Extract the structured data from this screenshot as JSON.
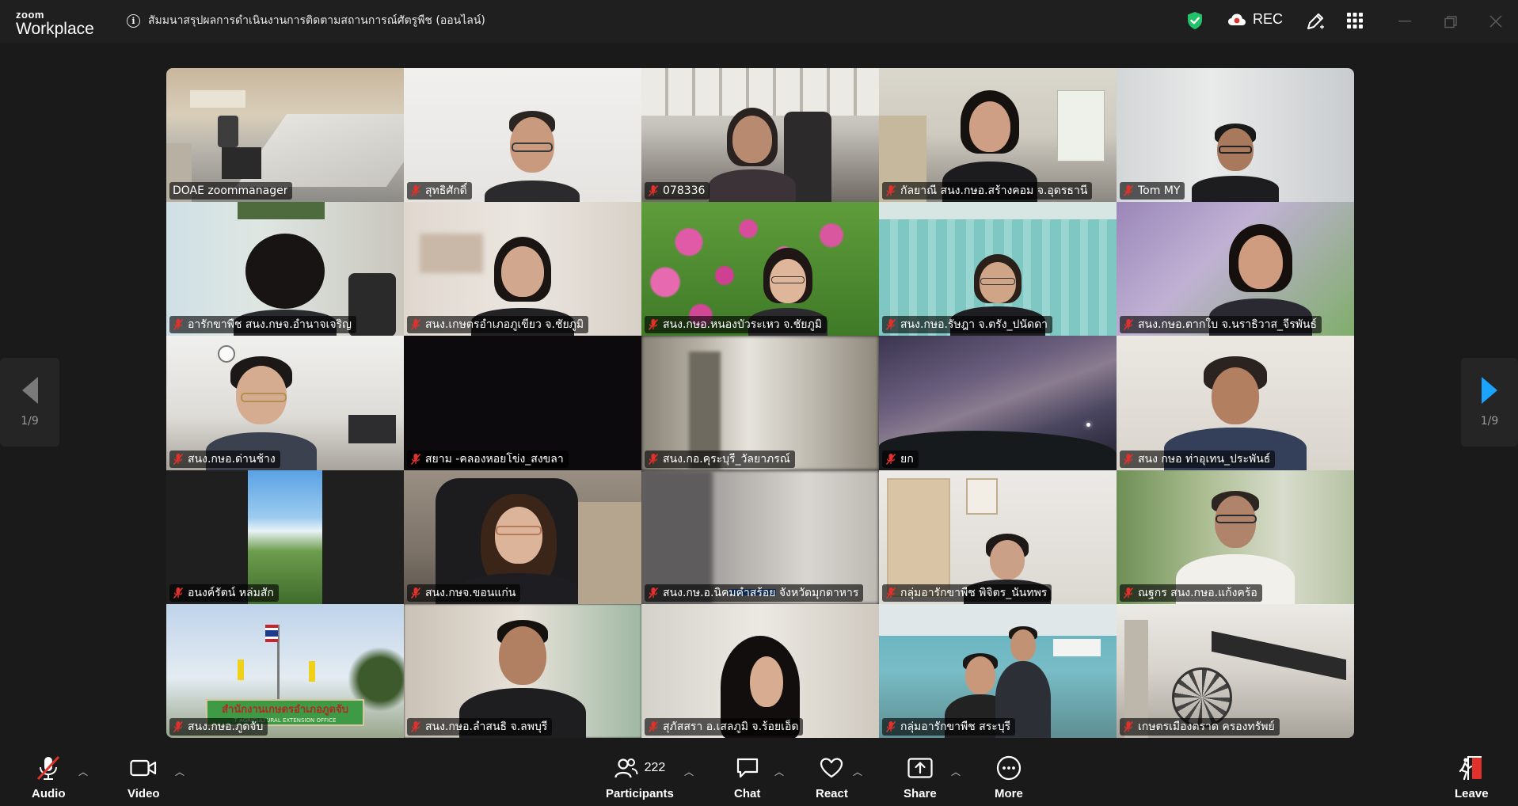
{
  "app": {
    "logo_line1": "zoom",
    "logo_line2": "Workplace",
    "meeting_title": "สัมมนาสรุปผลการดำเนินงานการติดตามสถานการณ์ศัตรูพืช (ออนไลน์)",
    "rec_label": "REC",
    "accent_color": "#00a3ff",
    "secure_color": "#21c26a",
    "muted_color": "#e0312b"
  },
  "gallery": {
    "page_left": "1/9",
    "page_right": "1/9",
    "tiles": [
      {
        "name": "DOAE zoommanager"
      },
      {
        "name": "สุทธิศักดิ์"
      },
      {
        "name": "078336"
      },
      {
        "name": "กัลยาณี สนง.กษอ.สร้างคอม จ.อุดรธานี"
      },
      {
        "name": "Tom MY"
      },
      {
        "name": "อารักขาพืช สนง.กษจ.อำนาจเจริญ"
      },
      {
        "name": "สนง.เกษตรอำเภอภูเขียว จ.ชัยภูมิ"
      },
      {
        "name": "สนง.กษอ.หนองบัวระเหว จ.ชัยภูมิ"
      },
      {
        "name": "สนง.กษอ.รัษฎา จ.ตรัง_ปนัดดา"
      },
      {
        "name": "สนง.กษอ.ตากใบ จ.นราธิวาส_จีรพันธ์"
      },
      {
        "name": "สนง.กษอ.ด่านช้าง"
      },
      {
        "name": "สยาม -คลองหอยโข่ง_สงขลา"
      },
      {
        "name": "สนง.กอ.คุระบุรี_วัลยาภรณ์"
      },
      {
        "name": "ยก"
      },
      {
        "name": "สนง กษอ ท่าอุเทน_ประพันธ์"
      },
      {
        "name": "อนงค์รัตน์ หล่มสัก"
      },
      {
        "name": "สนง.กษจ.ขอนแก่น"
      },
      {
        "name": "สนง.กษ.อ.นิคมคำสร้อย จังหวัดมุกดาหาร"
      },
      {
        "name": "กลุ่มอารักขาพืช พิจิตร_นันทพร"
      },
      {
        "name": "ณฐกร สนง.กษอ.แก้งคร้อ"
      },
      {
        "name": "สนง.กษอ.ภูดจับ"
      },
      {
        "name": "สนง.กษอ.ลำสนธิ จ.ลพบุรี"
      },
      {
        "name": "สุภัสสรา อ.เสลภูมิ จ.ร้อยเอ็ด"
      },
      {
        "name": "กลุ่มอารักขาพืช สระบุรี"
      },
      {
        "name": "เกษตรเมืองตราด ครองทรัพย์"
      }
    ],
    "scene_texts": {
      "office_sign": "สำนักงานเกษตรอำเภอภูดจับ",
      "office_sign_en": "T AGRICULTURAL EXTENSION OFFICE"
    }
  },
  "toolbar": {
    "audio": "Audio",
    "video": "Video",
    "participants": "Participants",
    "participants_count": "222",
    "chat": "Chat",
    "react": "React",
    "share": "Share",
    "more": "More",
    "leave": "Leave"
  }
}
